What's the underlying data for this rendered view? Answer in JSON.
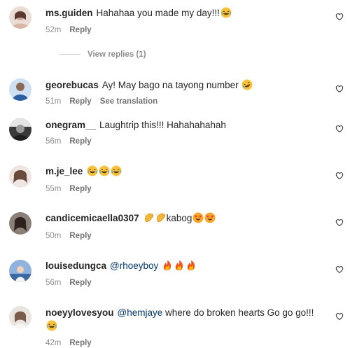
{
  "comments": [
    {
      "username": "ms.guiden",
      "text": "Hahahaa you made my day!!!",
      "emoji": [
        "laughing-emoji"
      ],
      "time": "52m",
      "reply_label": "Reply",
      "view_replies": "View replies (1)",
      "avatar_color": "#c9a99a"
    },
    {
      "username": "georebucas",
      "text": "Ay! May bago na tayong number",
      "emoji": [
        "rofl-emoji"
      ],
      "time": "51m",
      "reply_label": "Reply",
      "translation_label": "See translation",
      "avatar_color": "#3b6fb0"
    },
    {
      "username": "onegram__",
      "text": "Laughtrip this!!! Hahahahahah",
      "emoji": [],
      "time": "56m",
      "reply_label": "Reply",
      "avatar_color": "#2e2e2e"
    },
    {
      "username": "m.je_lee",
      "text": "",
      "emoji": [
        "laughing-emoji",
        "laughing-emoji",
        "laughing-emoji"
      ],
      "time": "55m",
      "reply_label": "Reply",
      "avatar_color": "#a07a6a"
    },
    {
      "username": "candicemicaella0307",
      "text": "kabog",
      "emoji_before": [
        "clap-emoji",
        "clap-emoji"
      ],
      "emoji": [
        "heart-eyes-emoji",
        "heart-eyes-emoji"
      ],
      "time": "50m",
      "reply_label": "Reply",
      "avatar_color": "#4a3f38"
    },
    {
      "username": "louisedungca",
      "mention": "@rhoeyboy",
      "emoji": [
        "fire-emoji",
        "fire-emoji",
        "fire-emoji"
      ],
      "time": "56m",
      "reply_label": "Reply",
      "avatar_color": "#5f88c2"
    },
    {
      "username": "noeyylovesyou",
      "mention": "@hemjaye",
      "text": "where do broken hearts Go go go!!!",
      "emoji": [
        "laughing-emoji"
      ],
      "time": "42m",
      "reply_label": "Reply",
      "avatar_color": "#cfc6c0"
    }
  ],
  "colors": {
    "username": "#262626",
    "meta": "#8e8e8e",
    "mention": "#00376b",
    "heart_outline": "#262626"
  }
}
